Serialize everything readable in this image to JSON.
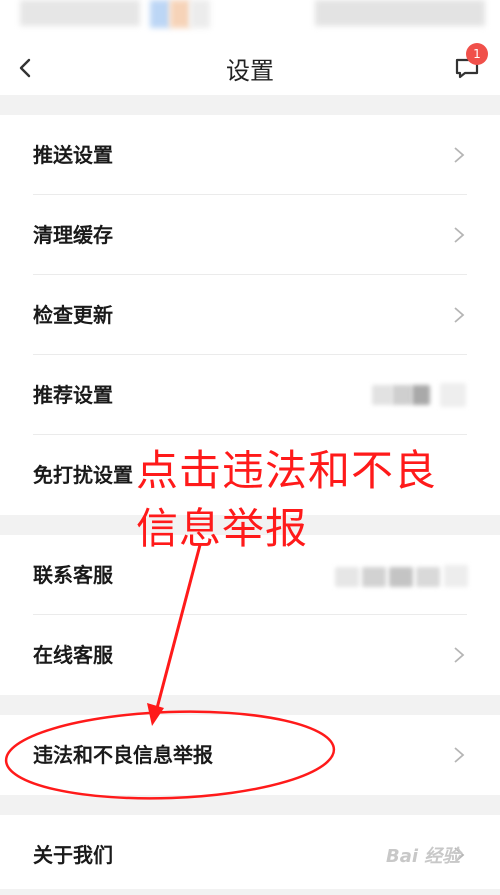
{
  "header": {
    "title": "设置",
    "badge_count": "1"
  },
  "groups": [
    {
      "items": [
        {
          "label": "推送设置"
        },
        {
          "label": "清理缓存"
        },
        {
          "label": "检查更新"
        },
        {
          "label": "推荐设置"
        },
        {
          "label": "免打扰设置"
        }
      ]
    },
    {
      "items": [
        {
          "label": "联系客服"
        },
        {
          "label": "在线客服"
        }
      ]
    },
    {
      "items": [
        {
          "label": "违法和不良信息举报"
        }
      ]
    },
    {
      "items": [
        {
          "label": "关于我们"
        }
      ]
    }
  ],
  "annotation": {
    "line1": "点击违法和不良",
    "line2": "信息举报",
    "color": "#ff1a1a"
  },
  "watermark": {
    "text": "Bai 经验"
  },
  "colors": {
    "background": "#f2f2f2",
    "surface": "#ffffff",
    "badge": "#f0504a",
    "chevron": "#b5b5b5"
  }
}
